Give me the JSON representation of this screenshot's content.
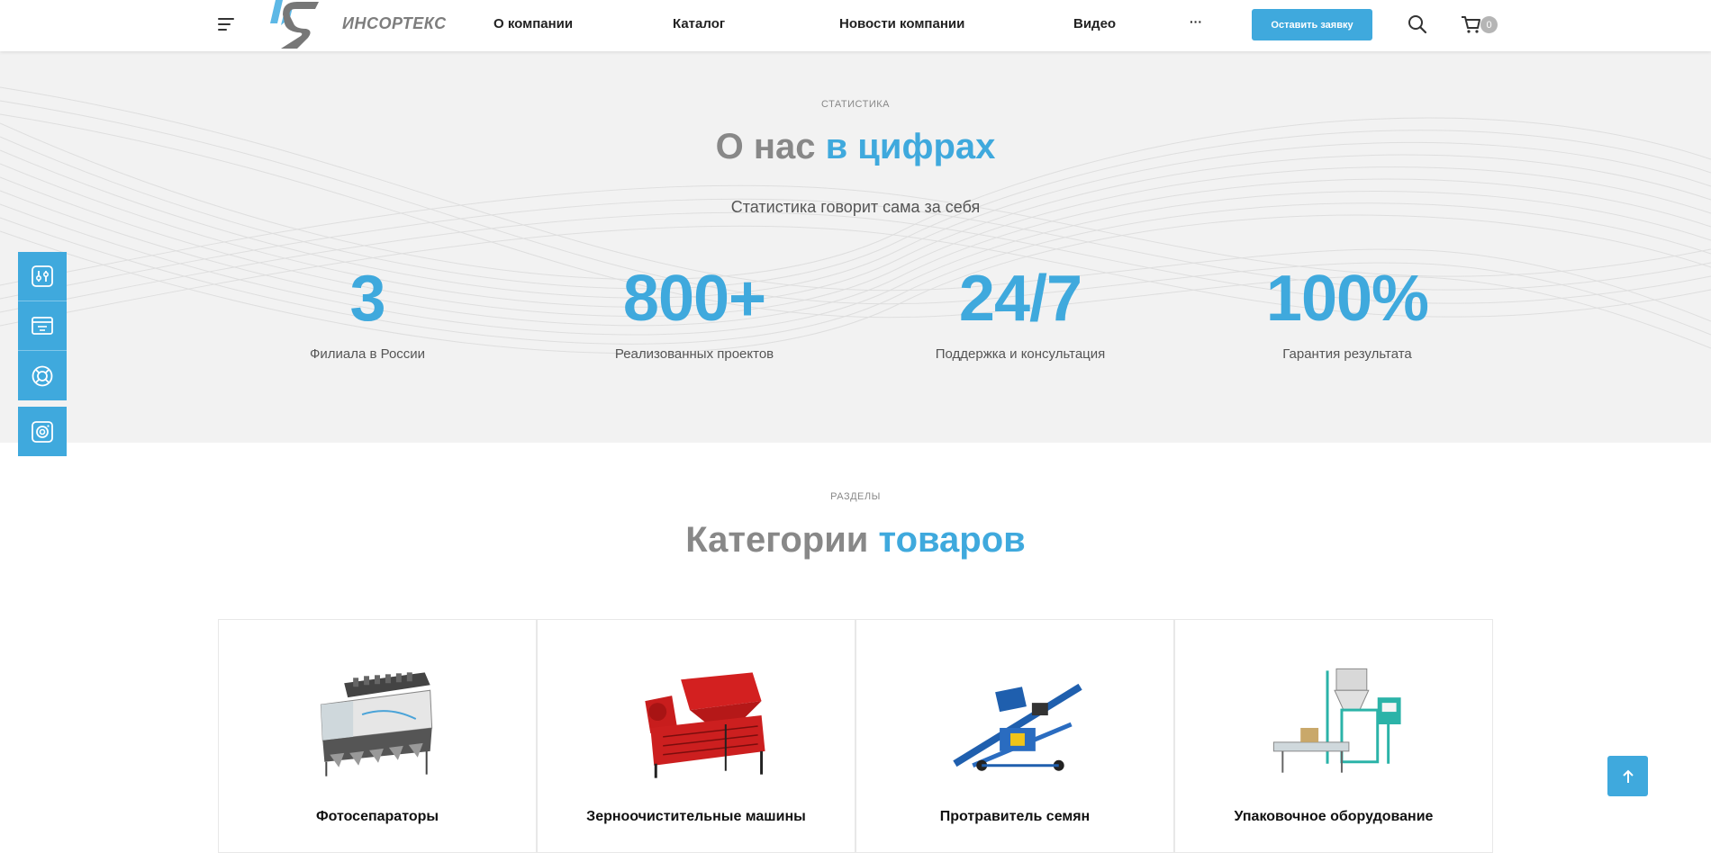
{
  "header": {
    "logo_text": "ИНСОРТЕКС",
    "nav": [
      "О компании",
      "Каталог",
      "Новости компании",
      "Видео",
      "···"
    ],
    "cta_label": "Оставить заявку",
    "cart_count": "0"
  },
  "stats": {
    "eyebrow": "СТАТИСТИКА",
    "title_grey": "О нас ",
    "title_blue": "в цифрах",
    "subtitle": "Статистика говорит сама за себя",
    "items": [
      {
        "value": "3",
        "label": "Филиала в России"
      },
      {
        "value": "800+",
        "label": "Реализованных проектов"
      },
      {
        "value": "24/7",
        "label": "Поддержка и консультация"
      },
      {
        "value": "100%",
        "label": "Гарантия результата"
      }
    ]
  },
  "categories": {
    "eyebrow": "РАЗДЕЛЫ",
    "title_grey": "Категории ",
    "title_blue": "товаров",
    "items": [
      {
        "name": "Фотосепараторы"
      },
      {
        "name": "Зерноочистительные машины"
      },
      {
        "name": "Протравитель семян"
      },
      {
        "name": "Упаковочное оборудование"
      }
    ]
  },
  "colors": {
    "accent": "#3fa9dd",
    "grey_title": "#888888",
    "stats_bg": "#f2f2f2"
  },
  "icons": [
    "menu-icon",
    "search-icon",
    "cart-icon",
    "sliders-icon",
    "payment-icon",
    "lifebuoy-icon",
    "camera-icon",
    "arrow-up-icon"
  ]
}
